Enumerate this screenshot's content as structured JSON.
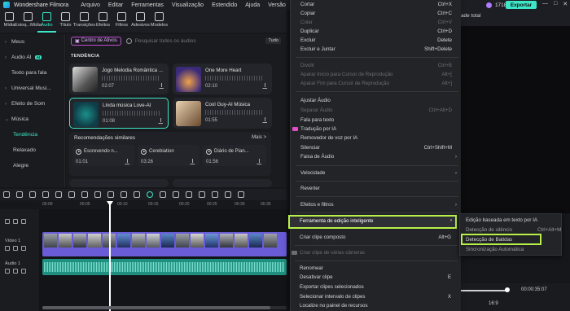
{
  "app": {
    "title": "Wondershare Filmora"
  },
  "menubar": [
    "Arquivo",
    "Editar",
    "Ferramentas",
    "Visualização",
    "Estendido",
    "Ajuda",
    "Versão"
  ],
  "toolbar": [
    {
      "label": "Mídia",
      "icon": "media-icon"
    },
    {
      "label": "Estoq...Mídia",
      "icon": "stock-media-icon"
    },
    {
      "label": "Áudio",
      "icon": "audio-icon",
      "active": true
    },
    {
      "label": "Título",
      "icon": "title-icon"
    },
    {
      "label": "Transições",
      "icon": "transitions-icon"
    },
    {
      "label": "Efeitos",
      "icon": "effects-icon"
    },
    {
      "label": "Filtros",
      "icon": "filters-icon"
    },
    {
      "label": "Adesivos",
      "icon": "stickers-icon"
    },
    {
      "label": "Modelos",
      "icon": "templates-icon"
    }
  ],
  "sidebar": {
    "items": [
      {
        "label": "Meus",
        "chevron": "›"
      },
      {
        "label": "Audio AI",
        "chevron": "›",
        "badge": "AI"
      },
      {
        "label": "Texto para fala",
        "chevron": ""
      },
      {
        "label": "Universal Musi...",
        "chevron": "›"
      },
      {
        "label": "Efeito de Som",
        "chevron": "›"
      },
      {
        "label": "Música",
        "chevron": "⌄"
      }
    ],
    "subitems": [
      {
        "label": "Tendência",
        "active": true
      },
      {
        "label": "Relaxado"
      },
      {
        "label": "Alegre"
      }
    ]
  },
  "content": {
    "center_button": "Centro de Ativos",
    "search_placeholder": "Pesquisar todos os áudios",
    "filter_label": "Tudo",
    "section_title": "TENDÊNCIA",
    "cards": [
      {
        "title": "Jogo Melodia Romântica ...",
        "duration": "02:07"
      },
      {
        "title": "One More Heart",
        "duration": "02:10"
      },
      {
        "title": "Linda música Love-AI",
        "duration": "01:08",
        "active": true
      },
      {
        "title": "Cool Guy-AI Música",
        "duration": "01:55"
      }
    ],
    "recommendations_title": "Recomendações similares",
    "more_label": "Mais >",
    "recommendations": [
      {
        "title": "Escrevendo n...",
        "duration": "01:01"
      },
      {
        "title": "Cerebiation",
        "duration": "03:26"
      },
      {
        "title": "Diário de Pian...",
        "duration": "01:56"
      }
    ]
  },
  "header_right": {
    "credits": "1718",
    "export_label": "Exportar",
    "dropdown": "ade total",
    "window_buttons": [
      "—",
      "□",
      "✕"
    ]
  },
  "timeline": {
    "ruler": [
      "00:00",
      "00:05",
      "00:10",
      "00:15",
      "00:20",
      "00:25",
      "00:30",
      "00:35",
      "00:40"
    ],
    "tracks": [
      {
        "label": "Vídeo 1"
      },
      {
        "label": "Áudio 1"
      }
    ]
  },
  "preview": {
    "time": "00:00:35:07",
    "ratio": "16:9"
  },
  "context_menu": {
    "items": [
      {
        "label": "Cortar",
        "shortcut": "Ctrl+X"
      },
      {
        "label": "Copiar",
        "shortcut": "Ctrl+C"
      },
      {
        "label": "Colar",
        "shortcut": "Ctrl+V",
        "disabled": true
      },
      {
        "label": "Duplicar",
        "shortcut": "Ctrl+D"
      },
      {
        "label": "Excluir",
        "shortcut": "Delete"
      },
      {
        "label": "Excluir e Juntar",
        "shortcut": "Shift+Delete"
      },
      {
        "label": "Dividir",
        "shortcut": "Ctrl+B",
        "disabled": true
      },
      {
        "label": "Aparar Início para Cursor de Reprodução",
        "shortcut": "Alt+[",
        "disabled": true
      },
      {
        "label": "Aparar Fim para Cursor de Reprodução",
        "shortcut": "Alt+]",
        "disabled": true
      },
      {
        "label": "Ajustar Áudio",
        "shortcut": ""
      },
      {
        "label": "Separar Áudio",
        "shortcut": "Ctrl+Alt+D",
        "disabled": true
      },
      {
        "label": "Fala para texto",
        "shortcut": ""
      },
      {
        "label": "Tradução por IA",
        "shortcut": "",
        "ai": true
      },
      {
        "label": "Removedor de voz por IA",
        "shortcut": ""
      },
      {
        "label": "Silenciar",
        "shortcut": "Ctrl+Shift+M"
      },
      {
        "label": "Faixa de Áudio",
        "shortcut": "",
        "submenu": true
      },
      {
        "label": "Velocidade",
        "shortcut": "",
        "submenu": true
      },
      {
        "label": "Reverter",
        "shortcut": ""
      },
      {
        "label": "Efeitos e filtros",
        "shortcut": "",
        "submenu": true
      },
      {
        "label": "Ferramenta de edição inteligente",
        "shortcut": "",
        "submenu": true,
        "highlighted": true
      },
      {
        "label": "Criar clipe composto",
        "shortcut": "Alt+G"
      },
      {
        "label": "Criar clipe de várias câmeras",
        "shortcut": "",
        "disabled": true
      },
      {
        "label": "Renomear",
        "shortcut": ""
      },
      {
        "label": "Desativar clipe",
        "shortcut": "E"
      },
      {
        "label": "Exportar clipes selecionados",
        "shortcut": ""
      },
      {
        "label": "Selecionar intervalo de clipes",
        "shortcut": "X"
      },
      {
        "label": "Localize no painel de recursos",
        "shortcut": ""
      }
    ]
  },
  "submenu": {
    "items": [
      {
        "label": "Edição baseada em texto por IA",
        "shortcut": ""
      },
      {
        "label": "Detecção de silêncio",
        "shortcut": "Ctrl+Alt+M"
      },
      {
        "label": "Detecção de Batidas",
        "shortcut": "",
        "highlighted": true
      },
      {
        "label": "Sincronização Automática",
        "shortcut": ""
      }
    ]
  },
  "colors": {
    "accent": "#3ee6c8",
    "highlight": "#b8f04a",
    "clip_video": "#6a5bd6",
    "clip_audio": "#1f8f80",
    "ai_pink": "#e34ec7"
  }
}
